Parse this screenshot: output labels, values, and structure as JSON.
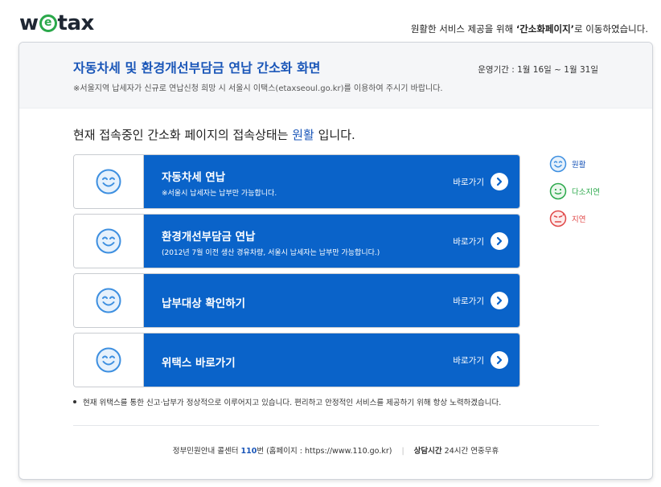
{
  "brand": {
    "logo_pre": "w",
    "logo_mark": "e",
    "logo_post": "tax"
  },
  "top_notice": {
    "pre": "원활한 서비스 제공을 위해 ",
    "bold": "‘간소화페이지’",
    "post": "로 이동하였습니다."
  },
  "header": {
    "title": "자동차세 및 환경개선부담금 연납 간소화 화면",
    "subtitle": "※서울지역 납세자가 신규로 연납신청 희망 시 서울시 이택스(etaxseoul.go.kr)를 이용하여 주시기 바랍니다.",
    "period": "운영기간 : 1월 16일 ~ 1월 31일"
  },
  "status": {
    "pre": "현재 접속중인 간소화 페이지의 접속상태는 ",
    "value": "원활",
    "post": " 입니다."
  },
  "services": [
    {
      "title": "자동차세 연납",
      "note": "※서울시 납세자는 납부만 가능합니다.",
      "go": "바로가기"
    },
    {
      "title": "환경개선부담금 연납",
      "note": "(2012년 7월 이전 생산 경유차량, 서울시 납세자는 납부만 가능합니다.)",
      "go": "바로가기"
    },
    {
      "title": "납부대상 확인하기",
      "note": "",
      "go": "바로가기"
    },
    {
      "title": "위택스 바로가기",
      "note": "",
      "go": "바로가기"
    }
  ],
  "legend": [
    {
      "label": "원활",
      "color": "#1a56b8"
    },
    {
      "label": "다소지연",
      "color": "#2aa84a"
    },
    {
      "label": "지연",
      "color": "#e04848"
    }
  ],
  "note": "현재 위택스를 통한 신고·납부가 정상적으로 이루어지고 있습니다. 편리하고 안정적인 서비스를 제공하기 위해 항상 노력하겠습니다.",
  "footer": {
    "center_pre": "정부민원안내 콜센터 ",
    "center_num": "110",
    "center_post": "번 (홈페이지 : https://www.110.go.kr)",
    "hours_label": "상담시간",
    "hours_value": " 24시간 연중무휴"
  }
}
